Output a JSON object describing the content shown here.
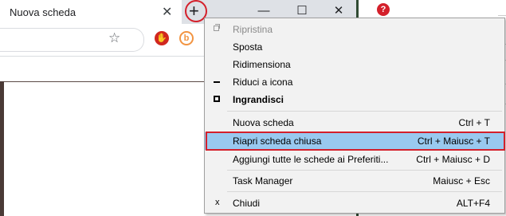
{
  "browser": {
    "tab_title": "Nuova scheda",
    "tab_close": "✕",
    "new_tab": "+",
    "win_minimize": "—",
    "win_maximize": "☐",
    "win_close": "✕",
    "bookmark_star": "☆"
  },
  "menu": {
    "items": [
      {
        "label": "Ripristina",
        "shortcut": "",
        "icon": "restore-icon",
        "state": "disabled"
      },
      {
        "label": "Sposta",
        "shortcut": "",
        "icon": "",
        "state": "normal"
      },
      {
        "label": "Ridimensiona",
        "shortcut": "",
        "icon": "",
        "state": "normal"
      },
      {
        "label": "Riduci a icona",
        "shortcut": "",
        "icon": "minimize-icon",
        "state": "normal"
      },
      {
        "label": "Ingrandisci",
        "shortcut": "",
        "icon": "maximize-icon",
        "state": "bold"
      },
      {
        "label": "Nuova scheda",
        "shortcut": "Ctrl + T",
        "icon": "",
        "state": "normal"
      },
      {
        "label": "Riapri scheda chiusa",
        "shortcut": "Ctrl + Maiusc + T",
        "icon": "",
        "state": "highlighted"
      },
      {
        "label": "Aggiungi tutte le schede ai Preferiti...",
        "shortcut": "Ctrl + Maiusc + D",
        "icon": "",
        "state": "normal"
      },
      {
        "label": "Task Manager",
        "shortcut": "Maiusc + Esc",
        "icon": "",
        "state": "normal"
      },
      {
        "label": "Chiudi",
        "shortcut": "ALT+F4",
        "icon": "close-icon",
        "state": "normal"
      }
    ],
    "close_glyph": "x"
  },
  "colors": {
    "highlight": "#99c9ef",
    "annotation_red": "#d4202b",
    "menu_bg": "#f2f2f2"
  }
}
